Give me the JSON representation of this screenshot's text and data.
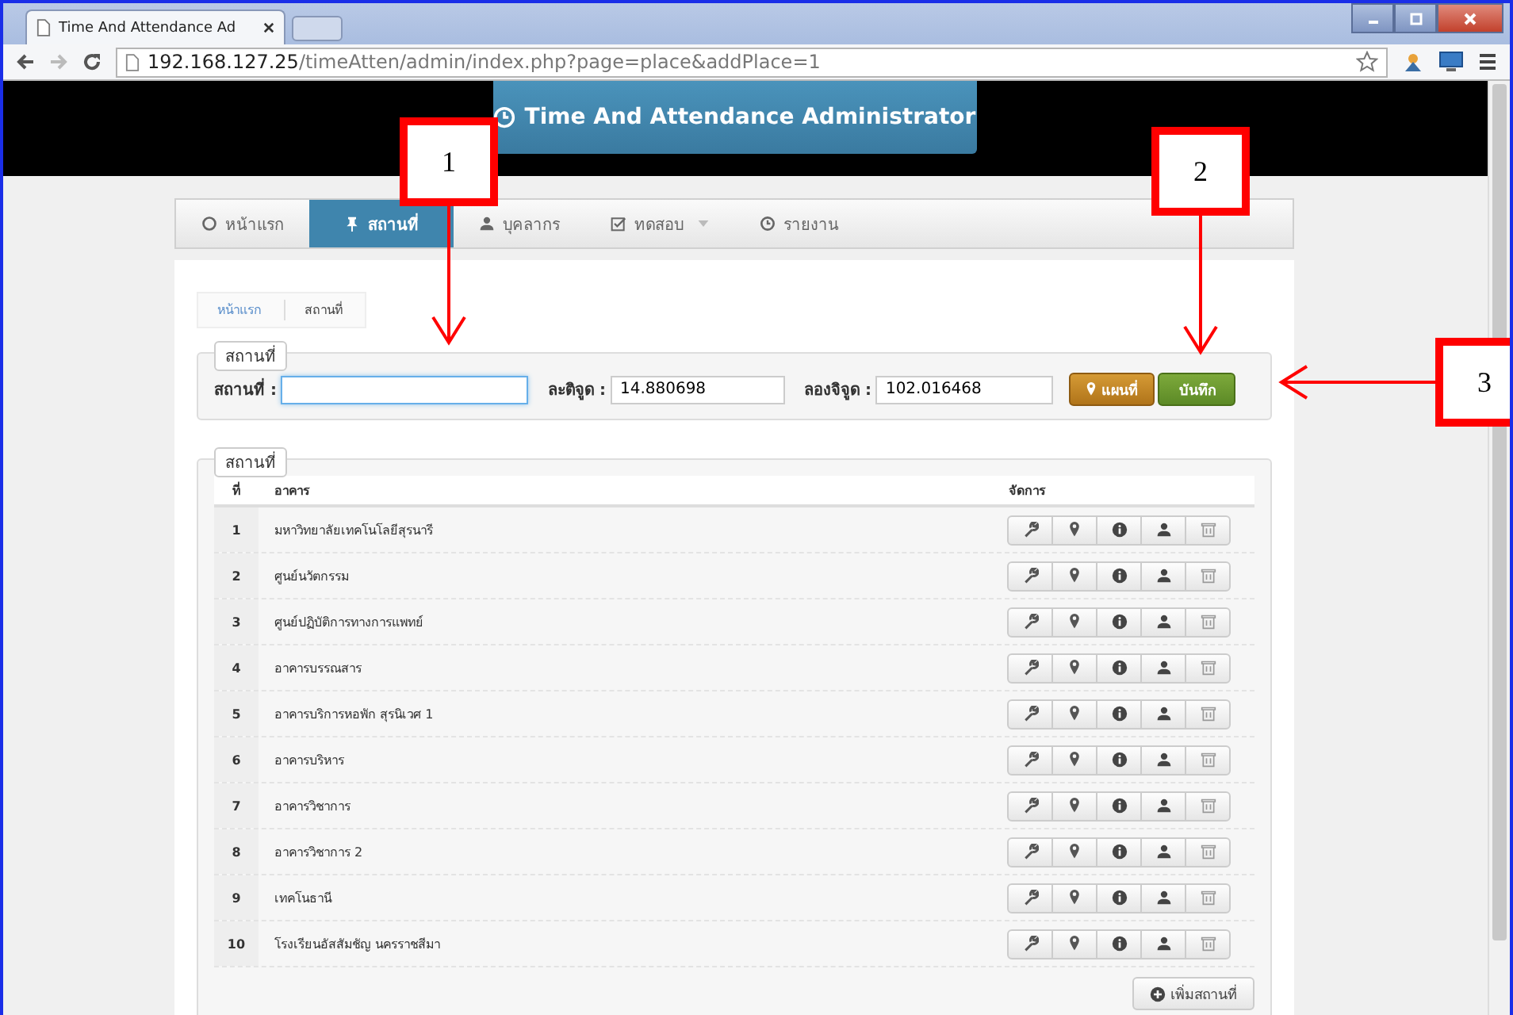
{
  "browser": {
    "tab_title": "Time And Attendance Ad",
    "address_host": "192.168.127.25",
    "address_path": "/timeAtten/admin/index.php?page=place&addPlace=1"
  },
  "header": {
    "title": "Time And Attendance Administrator"
  },
  "nav": [
    {
      "label": "หน้าแรก",
      "selected": false,
      "has_menu": false
    },
    {
      "label": "สถานที่",
      "selected": true,
      "has_menu": false
    },
    {
      "label": "บุคลากร",
      "selected": false,
      "has_menu": false
    },
    {
      "label": "ทดสอบ",
      "selected": false,
      "has_menu": true
    },
    {
      "label": "รายงาน",
      "selected": false,
      "has_menu": false
    }
  ],
  "breadcrumb": [
    {
      "label": "หน้าแรก",
      "kind": "link"
    },
    {
      "label": "สถานที่",
      "kind": "current"
    }
  ],
  "form": {
    "legend": "สถานที่",
    "fields": [
      {
        "label": "สถานที่ :",
        "focused": true
      },
      {
        "label": "ละติจูด :",
        "value": "14.880698",
        "focused": false
      },
      {
        "label": "ลองจิจูด :",
        "value": "102.016468",
        "focused": false
      }
    ],
    "map_button": "แผนที่",
    "save_button": "บันทึก"
  },
  "table": {
    "legend": "สถานที่",
    "columns": [
      "ที่",
      "อาคาร",
      "จัดการ"
    ],
    "rows": [
      {
        "no": "1",
        "name": "มหาวิทยาลัยเทคโนโลยีสุรนารี"
      },
      {
        "no": "2",
        "name": "ศูนย์นวัตกรรม"
      },
      {
        "no": "3",
        "name": "ศูนย์ปฏิบัติการทางการแพทย์"
      },
      {
        "no": "4",
        "name": "อาคารบรรณสาร"
      },
      {
        "no": "5",
        "name": "อาคารบริการหอพัก สุรนิเวศ 1"
      },
      {
        "no": "6",
        "name": "อาคารบริหาร"
      },
      {
        "no": "7",
        "name": "อาคารวิชาการ"
      },
      {
        "no": "8",
        "name": "อาคารวิชาการ 2"
      },
      {
        "no": "9",
        "name": "เทคโนธานี"
      },
      {
        "no": "10",
        "name": "โรงเรียนอัสสัมชัญ นครราชสีมา"
      }
    ],
    "add_button": "เพิ่มสถานที่"
  },
  "annotations": [
    {
      "label": "1"
    },
    {
      "label": "2"
    },
    {
      "label": "3"
    }
  ]
}
